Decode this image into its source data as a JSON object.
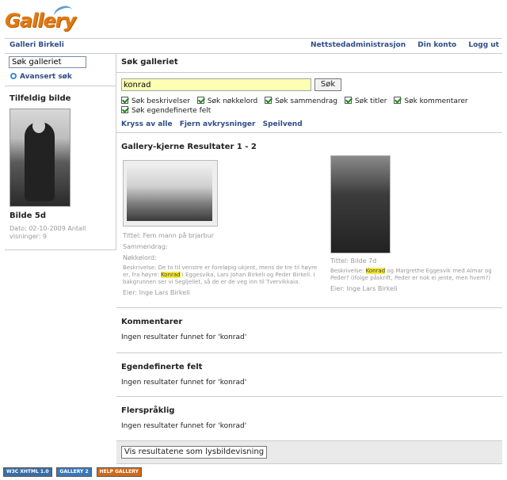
{
  "logo": {
    "text": "Gallery"
  },
  "header": {
    "site_title": "Galleri Birkeli",
    "links": [
      "Nettstedadministrasjon",
      "Din konto",
      "Logg ut"
    ]
  },
  "sidebar": {
    "search_value": "Søk galleriet",
    "advanced_search": "Avansert søk",
    "random_title": "Tilfeldig bilde",
    "random_name": "Bilde 5d",
    "random_meta": "Dato: 02-10-2009 Antall visninger: 9"
  },
  "search": {
    "heading": "Søk galleriet",
    "query": "konrad",
    "button": "Søk",
    "options": [
      "Søk beskrivelser",
      "Søk nøkkelord",
      "Søk sammendrag",
      "Søk titler",
      "Søk kommentarer",
      "Søk egendefinerte felt"
    ],
    "links": [
      "Kryss av alle",
      "Fjern avkrysninger",
      "Speilvend"
    ]
  },
  "results": {
    "heading": "Gallery-kjerne Resultater  1 - 2",
    "items": [
      {
        "title": "Tittel: Fem mann på brjarbur",
        "summary": "Sammendrag:",
        "keywords": "Nøkkelord:",
        "desc_pre": "Beskrivelse: De to til venstre er foreløpig ukjent, mens de tre til høyre er, fra høyre:",
        "desc_hl": "Konrad",
        "desc_post": "i Eggesvika, Lars Johan Birkeli og Peder Birkeli. I bakgrunnen ser vi Segljellet, så de er de veg inn til Tvervikkaia.",
        "owner": "Eier: Inge Lars Birkeli"
      },
      {
        "title": "Tittel: Bilde 7d",
        "desc_pre": "Beskrivelse:",
        "desc_hl": "Konrad",
        "desc_post": "og Margrethe Eggesvik med Almar og Peder? (ifolge påskrift, Peder er nok ei jente, men hvem?)",
        "owner": "Eier: Inge Lars Birkeli"
      }
    ]
  },
  "sections": [
    {
      "heading": "Kommentarer",
      "message": "Ingen resultater funnet for 'konrad'"
    },
    {
      "heading": "Egendefinerte felt",
      "message": "Ingen resultater funnet for 'konrad'"
    },
    {
      "heading": "Flerspråklig",
      "message": "Ingen resultater funnet for 'konrad'"
    }
  ],
  "slideshow_button": "Vis resultatene som lysbildevisning",
  "badges": [
    {
      "text": "W3C XHTML 1.0",
      "color": "#3a6da6"
    },
    {
      "text": "GALLERY 2",
      "color": "#3a78b8"
    },
    {
      "text": "HELP GALLERY",
      "color": "#d06a1a"
    }
  ]
}
